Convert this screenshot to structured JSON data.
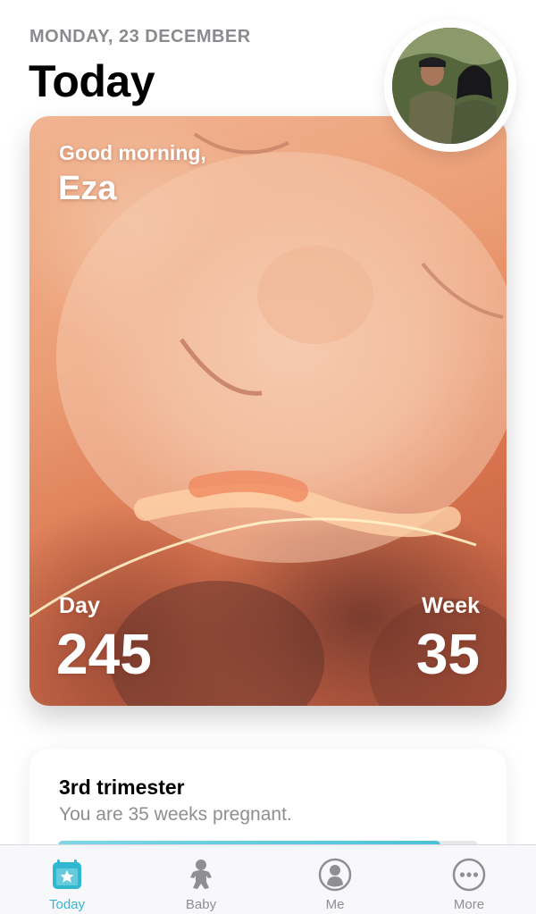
{
  "header": {
    "date": "MONDAY, 23 DECEMBER",
    "title": "Today"
  },
  "hero": {
    "greeting": "Good morning,",
    "name": "Eza",
    "day_label": "Day",
    "day_value": "245",
    "week_label": "Week",
    "week_value": "35"
  },
  "trimester": {
    "title": "3rd trimester",
    "subtitle": "You are 35 weeks pregnant.",
    "progress": 0.91
  },
  "tabbar": {
    "items": [
      {
        "label": "Today",
        "icon": "calendar-star-icon",
        "active": true
      },
      {
        "label": "Baby",
        "icon": "baby-icon",
        "active": false
      },
      {
        "label": "Me",
        "icon": "person-icon",
        "active": false
      },
      {
        "label": "More",
        "icon": "more-dots-icon",
        "active": false
      }
    ]
  },
  "colors": {
    "accent": "#31b8d0",
    "inactive": "#8e8e93",
    "hero_base": "#eb9d74"
  }
}
